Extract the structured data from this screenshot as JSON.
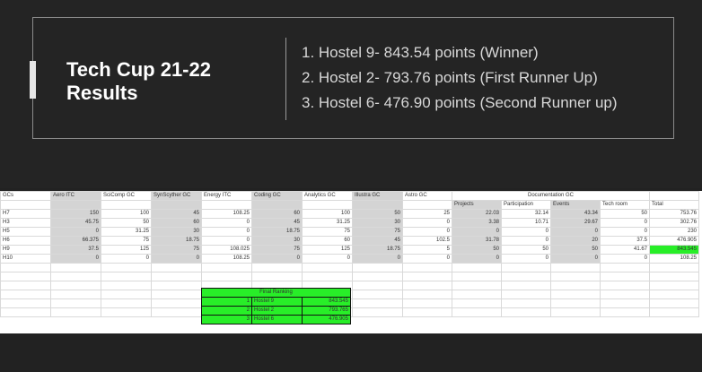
{
  "slide": {
    "title_line1": "Tech Cup 21-22",
    "title_line2": "Results",
    "results": [
      "1. Hostel 9- 843.54 points (Winner)",
      "2. Hostel 2- 793.76 points (First Runner Up)",
      "3. Hostel 6- 476.90 points (Second Runner up)"
    ]
  },
  "sheet": {
    "headers": [
      "GCs",
      "Aero ITC",
      "SciComp GC",
      "SynScyther GC",
      "Energy ITC",
      "Coding GC",
      "Analytics GC",
      "Illustra GC",
      "Astro GC",
      "",
      "Documentation GC",
      "",
      "",
      "",
      ""
    ],
    "subheaders": [
      "Projects",
      "Participation",
      "Events",
      "Tech room",
      "Total"
    ],
    "rows": [
      [
        "H7",
        "150",
        "100",
        "45",
        "108.25",
        "60",
        "100",
        "50",
        "25",
        "22.03",
        "32.14",
        "43.34",
        "50",
        "753.76"
      ],
      [
        "H3",
        "45.75",
        "50",
        "60",
        "0",
        "45",
        "31.25",
        "30",
        "0",
        "3.38",
        "10.71",
        "29.67",
        "0",
        "302.76"
      ],
      [
        "H5",
        "0",
        "31.25",
        "30",
        "0",
        "18.75",
        "75",
        "75",
        "0",
        "0",
        "0",
        "0",
        "0",
        "230"
      ],
      [
        "H6",
        "66.375",
        "75",
        "18.75",
        "0",
        "30",
        "60",
        "45",
        "102.5",
        "31.78",
        "0",
        "20",
        "37.5",
        "476.905"
      ],
      [
        "H9",
        "37.5",
        "125",
        "75",
        "108.025",
        "75",
        "125",
        "18.75",
        "5",
        "50",
        "50",
        "50",
        "41.67",
        "843.545"
      ],
      [
        "H10",
        "0",
        "0",
        "0",
        "108.25",
        "0",
        "0",
        "0",
        "0",
        "0",
        "0",
        "0",
        "0",
        "108.25"
      ]
    ],
    "ranking": {
      "title": "Final Ranking",
      "rows": [
        [
          "1",
          "Hostel 9",
          "843.545"
        ],
        [
          "2",
          "Hostel 2",
          "793.765"
        ],
        [
          "3",
          "Hostel 6",
          "476.905"
        ]
      ]
    }
  }
}
